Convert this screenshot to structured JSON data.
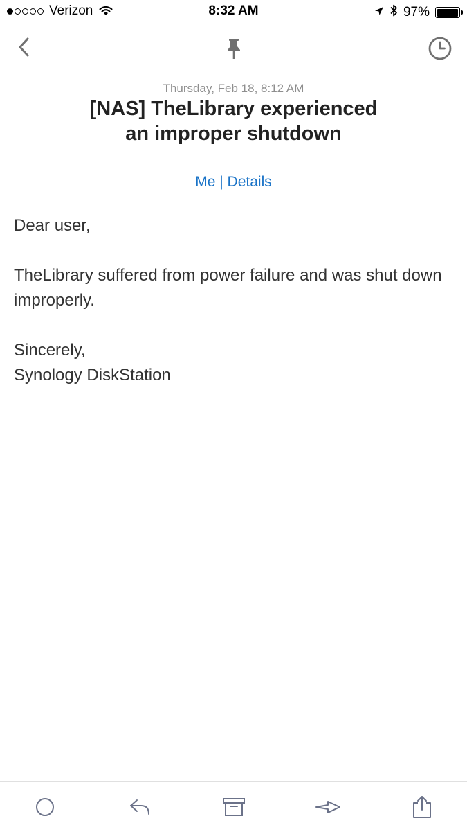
{
  "status_bar": {
    "carrier": "Verizon",
    "time": "8:32 AM",
    "battery_percent": "97%",
    "battery_level": 0.97,
    "signal_bars_filled": 1,
    "signal_bars_total": 5
  },
  "nav": {
    "back_icon": "chevron-left-icon",
    "pin_icon": "pin-icon",
    "snooze_icon": "clock-icon"
  },
  "message": {
    "date": "Thursday, Feb 18, 8:12 AM",
    "subject": "[NAS]  TheLibrary experienced an improper shutdown",
    "recipient": "Me",
    "separator": " | ",
    "details_link": "Details",
    "body": [
      "Dear user,",
      "TheLibrary suffered from power failure and was shut down improperly.",
      "Sincerely,",
      "Synology DiskStation"
    ]
  },
  "toolbar": {
    "icons": [
      "circle-icon",
      "reply-icon",
      "archive-icon",
      "forward-icon",
      "share-icon"
    ]
  },
  "colors": {
    "link": "#1a73c7",
    "toolbar_icon": "#6b7289",
    "nav_icon": "#707070",
    "date_text": "#8e8e8e"
  }
}
